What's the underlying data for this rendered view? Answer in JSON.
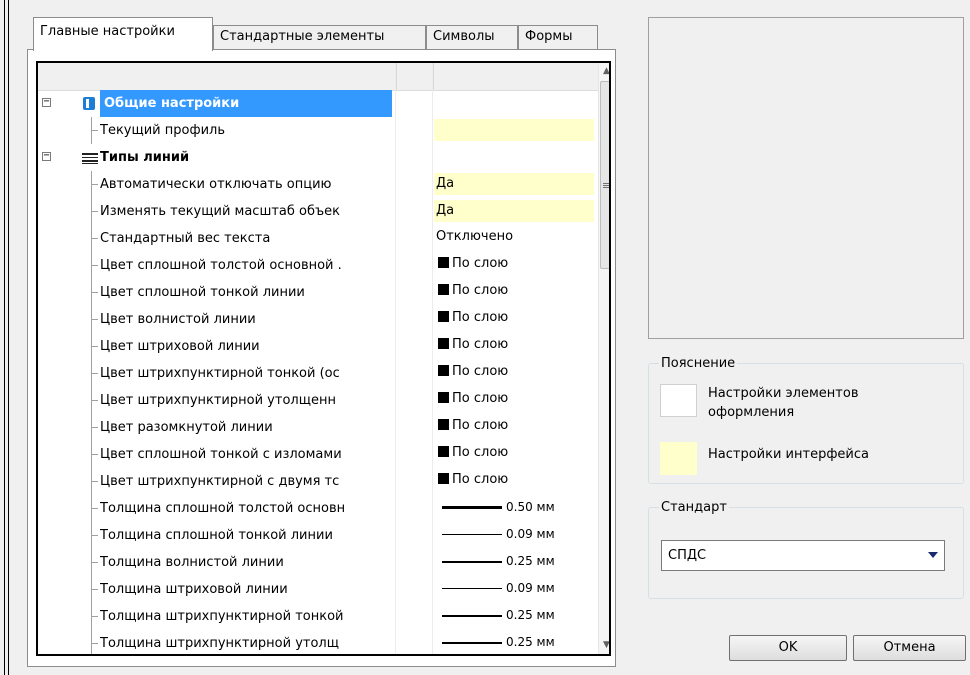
{
  "tabs": [
    "Главные настройки",
    "Стандартные элементы",
    "Символы",
    "Формы"
  ],
  "rows": [
    {
      "type": "group",
      "label": "Общие настройки",
      "selected": true,
      "icon": "app-icon"
    },
    {
      "type": "item",
      "label": "Текущий профиль",
      "value": "",
      "yellow": true
    },
    {
      "type": "group",
      "label": "Типы линий",
      "icon": "line-types-icon"
    },
    {
      "type": "item",
      "label": "Автоматически отключать опцию",
      "value": "Да",
      "yellow": true
    },
    {
      "type": "item",
      "label": "Изменять текущий масштаб объек",
      "value": "Да",
      "yellow": true
    },
    {
      "type": "item",
      "label": "Стандартный вес текста",
      "value": "Отключено"
    },
    {
      "type": "item",
      "label": "Цвет сплошной толстой основной .",
      "value": "По слою",
      "kind": "color"
    },
    {
      "type": "item",
      "label": "Цвет сплошной тонкой линии",
      "value": "По слою",
      "kind": "color"
    },
    {
      "type": "item",
      "label": "Цвет волнистой линии",
      "value": "По слою",
      "kind": "color"
    },
    {
      "type": "item",
      "label": "Цвет штриховой линии",
      "value": "По слою",
      "kind": "color"
    },
    {
      "type": "item",
      "label": "Цвет штрихпунктирной тонкой (ос",
      "value": "По слою",
      "kind": "color"
    },
    {
      "type": "item",
      "label": "Цвет штрихпунктирной утолщенн",
      "value": "По слою",
      "kind": "color"
    },
    {
      "type": "item",
      "label": "Цвет разомкнутой линии",
      "value": "По слою",
      "kind": "color"
    },
    {
      "type": "item",
      "label": "Цвет сплошной тонкой с изломами",
      "value": "По слою",
      "kind": "color"
    },
    {
      "type": "item",
      "label": "Цвет штрихпунктирной с двумя тс",
      "value": "По слою",
      "kind": "color"
    },
    {
      "type": "item",
      "label": "Толщина сплошной толстой основн",
      "value": "0.50 мм",
      "kind": "width",
      "weight": 0.5
    },
    {
      "type": "item",
      "label": "Толщина сплошной тонкой линии",
      "value": "0.09 мм",
      "kind": "width",
      "weight": 0.09
    },
    {
      "type": "item",
      "label": "Толщина волнистой линии",
      "value": "0.25 мм",
      "kind": "width",
      "weight": 0.25
    },
    {
      "type": "item",
      "label": "Толщина штриховой линии",
      "value": "0.09 мм",
      "kind": "width",
      "weight": 0.09
    },
    {
      "type": "item",
      "label": "Толщина штрихпунктирной тонкой",
      "value": "0.25 мм",
      "kind": "width",
      "weight": 0.25
    },
    {
      "type": "item",
      "label": "Толщина штрихпунктирной утолщ",
      "value": "0.25 мм",
      "kind": "width",
      "weight": 0.25
    }
  ],
  "legend": {
    "title": "Пояснение",
    "items": [
      {
        "label": "Настройки элементов оформления",
        "color": "#ffffff"
      },
      {
        "label": "Настройки интерфейса",
        "color": "#ffffcc"
      }
    ]
  },
  "standard": {
    "title": "Стандарт",
    "value": "СПДС"
  },
  "buttons": {
    "ok": "OK",
    "cancel": "Отмена"
  }
}
